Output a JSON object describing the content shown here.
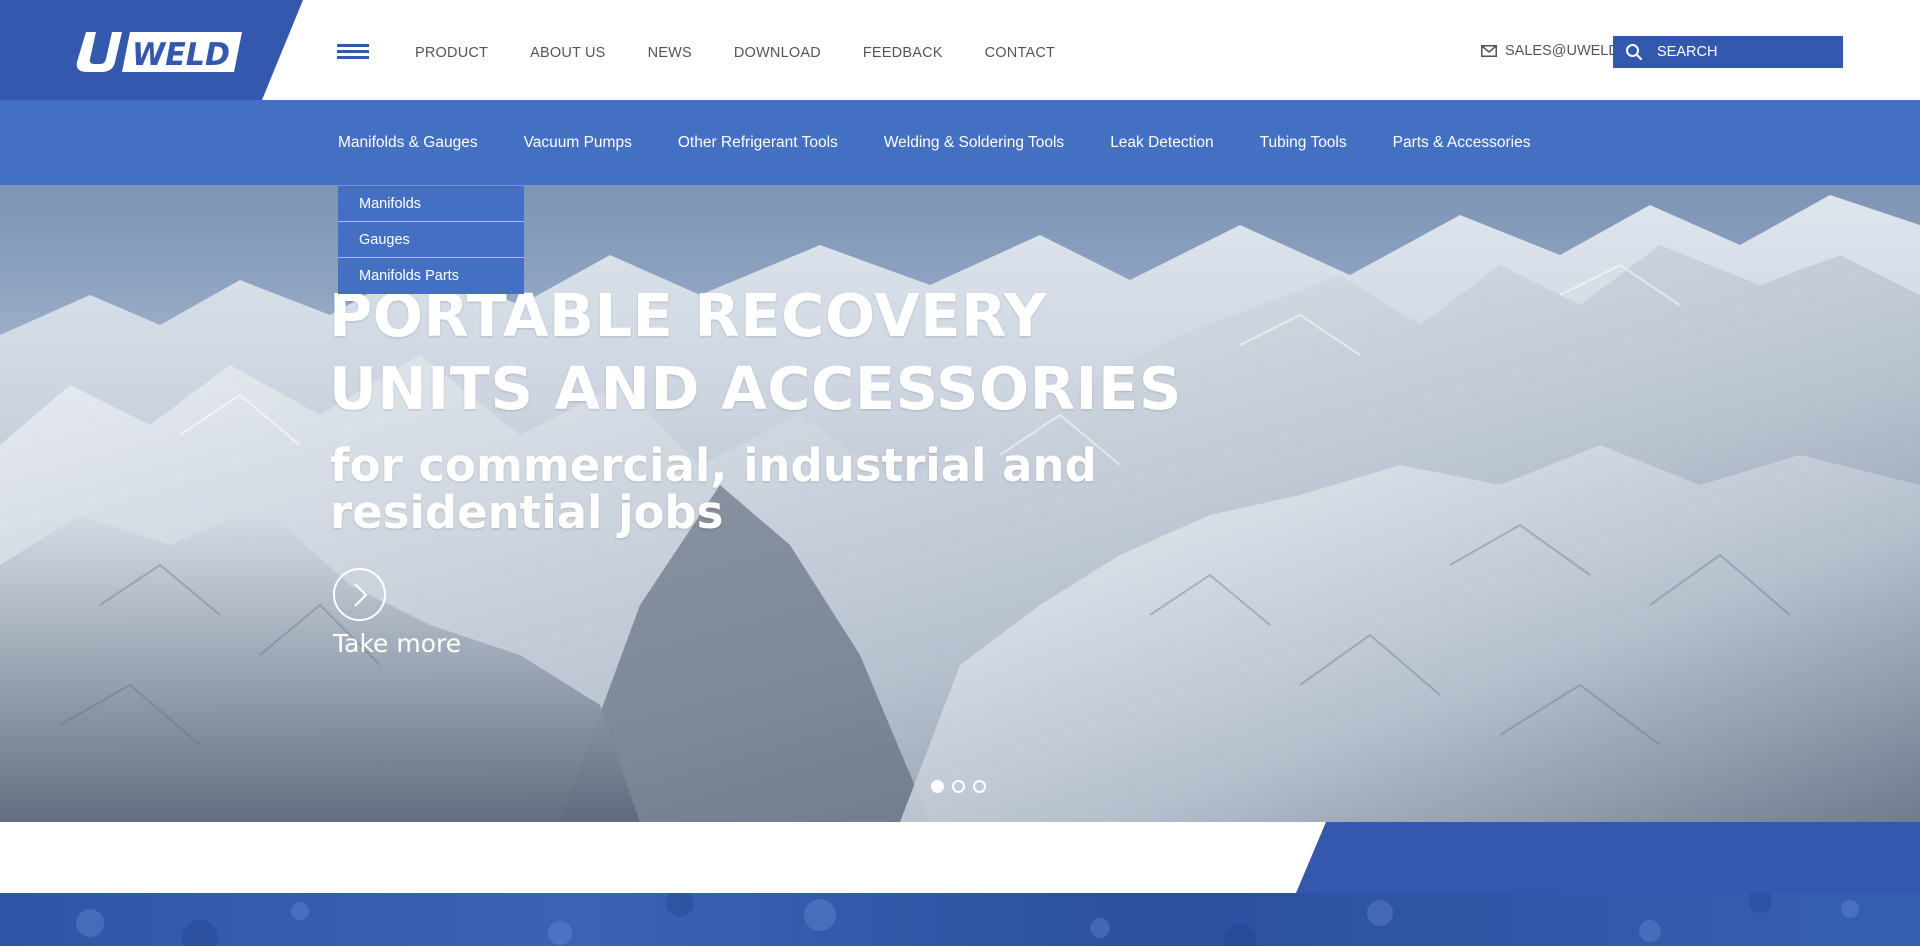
{
  "brand": {
    "logo_text": "UWELD",
    "color_primary": "#3458ad",
    "color_secondary": "#4470c4"
  },
  "top_nav": {
    "items": [
      "PRODUCT",
      "ABOUT US",
      "NEWS",
      "DOWNLOAD",
      "FEEDBACK",
      "CONTACT"
    ],
    "menu_icon": "hamburger-icon"
  },
  "contact": {
    "email_text": "SALES@UWELD",
    "icon": "mail-icon"
  },
  "search": {
    "placeholder": "SEARCH",
    "value": "",
    "icon": "search-icon"
  },
  "categories": [
    "Manifolds & Gauges",
    "Vacuum Pumps",
    "Other Refrigerant Tools",
    "Welding & Soldering Tools",
    "Leak Detection",
    "Tubing Tools",
    "Parts & Accessories"
  ],
  "dropdown": {
    "items": [
      "Manifolds",
      "Gauges",
      "Manifolds Parts"
    ]
  },
  "hero": {
    "title_line1": "PORTABLE RECOVERY",
    "title_line2": "UNITS AND ACCESSORIES",
    "subtitle_line1": "for commercial, industrial and",
    "subtitle_line2": "residential jobs",
    "cta_label": "Take more",
    "cta_icon": "chevron-right-icon",
    "slides_count": 3,
    "active_slide": 1
  }
}
